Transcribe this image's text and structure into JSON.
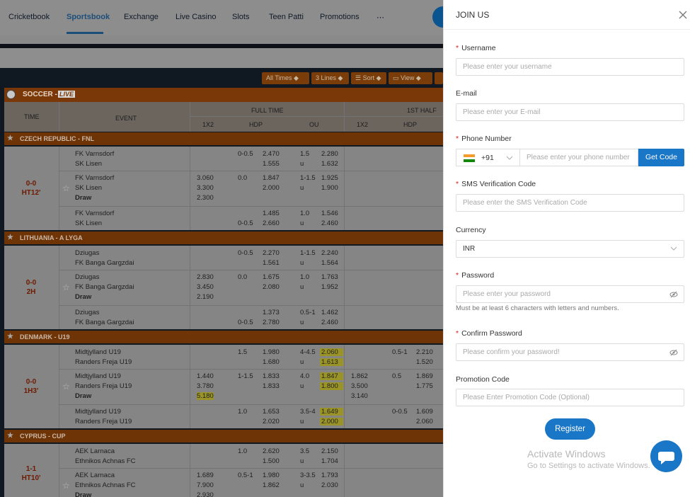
{
  "nav": {
    "items": [
      "Cricketbook",
      "Sportsbook",
      "Exchange",
      "Live Casino",
      "Slots",
      "Teen Patti",
      "Promotions",
      "⋯"
    ],
    "active": "Sportsbook"
  },
  "toolbar": {
    "all_times": "All Times",
    "lines": "3 Lines",
    "sort": "Sort",
    "view": "View"
  },
  "sport": {
    "name": "SOCCER -",
    "live": "LIVE"
  },
  "headers": {
    "time": "TIME",
    "event": "EVENT",
    "full_time": "FULL TIME",
    "first_half": "1ST HALF",
    "c1x2": "1X2",
    "hdp": "HDP",
    "ou": "OU",
    "c1x2b": "1X2",
    "hdpb": "HDP"
  },
  "leagues": [
    {
      "name": "CZECH REPUBLIC - FNL",
      "score": "0-0",
      "time": "HT12'",
      "rows": [
        {
          "teams": [
            "FK Varnsdorf",
            "SK Lisen"
          ],
          "x12": [],
          "hdp_line": [
            "0-0.5",
            ""
          ],
          "hdp": [
            "2.470",
            "1.555"
          ],
          "ou_line": [
            "1.5",
            "u"
          ],
          "ou": [
            "2.280",
            "1.632"
          ]
        },
        {
          "teams": [
            "FK Varnsdorf",
            "SK Lisen",
            "Draw"
          ],
          "x12": [
            "3.060",
            "3.300",
            "2.300"
          ],
          "hdp_line": [
            "0.0",
            ""
          ],
          "hdp": [
            "1.847",
            "2.000"
          ],
          "ou_line": [
            "1-1.5",
            "u"
          ],
          "ou": [
            "1.925",
            "1.900"
          ]
        },
        {
          "teams": [
            "FK Varnsdorf",
            "SK Lisen"
          ],
          "x12": [],
          "hdp_line": [
            "",
            "0-0.5"
          ],
          "hdp": [
            "1.485",
            "2.660"
          ],
          "ou_line": [
            "1.0",
            "u"
          ],
          "ou": [
            "1.546",
            "2.460"
          ]
        }
      ]
    },
    {
      "name": "LITHUANIA - A LYGA",
      "score": "0-0",
      "time": "2H",
      "rows": [
        {
          "teams": [
            "Dziugas",
            "FK Banga Gargzdai"
          ],
          "x12": [],
          "hdp_line": [
            "0-0.5",
            ""
          ],
          "hdp": [
            "2.270",
            "1.561"
          ],
          "ou_line": [
            "1-1.5",
            "u"
          ],
          "ou": [
            "2.240",
            "1.564"
          ]
        },
        {
          "teams": [
            "Dziugas",
            "FK Banga Gargzdai",
            "Draw"
          ],
          "x12": [
            "2.830",
            "3.450",
            "2.190"
          ],
          "hdp_line": [
            "0.0",
            ""
          ],
          "hdp": [
            "1.675",
            "2.080"
          ],
          "ou_line": [
            "1.0",
            "u"
          ],
          "ou": [
            "1.763",
            "1.952"
          ]
        },
        {
          "teams": [
            "Dziugas",
            "FK Banga Gargzdai"
          ],
          "x12": [],
          "hdp_line": [
            "",
            "0-0.5"
          ],
          "hdp": [
            "1.373",
            "2.780"
          ],
          "ou_line": [
            "0.5-1",
            "u"
          ],
          "ou": [
            "1.462",
            "2.460"
          ]
        }
      ]
    },
    {
      "name": "DENMARK - U19",
      "score": "0-0",
      "time": "1H3'",
      "rows": [
        {
          "teams": [
            "Midtjylland U19",
            "Randers Freja U19"
          ],
          "x12": [],
          "hdp_line": [
            "1.5",
            ""
          ],
          "hdp": [
            "1.980",
            "1.680"
          ],
          "ou_line": [
            "4-4.5",
            "u"
          ],
          "ou": [
            "2.060",
            "1.613"
          ],
          "ou_hl": true,
          "h_x12": [],
          "h_line": [
            "0.5-1",
            ""
          ],
          "h_hdp": [
            "2.210",
            "1.520"
          ]
        },
        {
          "teams": [
            "Midtjylland U19",
            "Randers Freja U19",
            "Draw"
          ],
          "x12": [
            "1.440",
            "3.780",
            "5.180"
          ],
          "hdp_line": [
            "1-1.5",
            ""
          ],
          "hdp": [
            "1.833",
            "1.833"
          ],
          "ou_line": [
            "4.0",
            "u"
          ],
          "ou": [
            "1.847",
            "1.800"
          ],
          "ou_hl": true,
          "h_x12": [
            "1.862",
            "3.500",
            "3.140"
          ],
          "h_line": [
            "0.5",
            ""
          ],
          "h_hdp": [
            "1.869",
            "1.775"
          ]
        },
        {
          "teams": [
            "Midtjylland U19",
            "Randers Freja U19"
          ],
          "x12": [],
          "hdp_line": [
            "1.0",
            ""
          ],
          "hdp": [
            "1.653",
            "2.020"
          ],
          "ou_line": [
            "3.5-4",
            "u"
          ],
          "ou": [
            "1.649",
            "2.000"
          ],
          "ou_hl": true,
          "h_x12": [],
          "h_line": [
            "0-0.5",
            ""
          ],
          "h_hdp": [
            "1.609",
            "2.060"
          ]
        }
      ]
    },
    {
      "name": "CYPRUS - CUP",
      "score": "1-1",
      "time": "HT10'",
      "rows": [
        {
          "teams": [
            "AEK Larnaca",
            "Ethnikos Achnas FC"
          ],
          "x12": [],
          "hdp_line": [
            "1.0",
            ""
          ],
          "hdp": [
            "2.620",
            "1.500"
          ],
          "ou_line": [
            "3.5",
            "u"
          ],
          "ou": [
            "2.150",
            "1.704"
          ]
        },
        {
          "teams": [
            "AEK Larnaca",
            "Ethnikos Achnas FC",
            "Draw"
          ],
          "x12": [
            "1.689",
            "7.900",
            "2.930"
          ],
          "hdp_line": [
            "0.5-1",
            ""
          ],
          "hdp": [
            "1.980",
            "1.862"
          ],
          "ou_line": [
            "3-3.5",
            "u"
          ],
          "ou": [
            "1.793",
            "2.030"
          ]
        }
      ]
    }
  ],
  "panel": {
    "title": "JOIN US",
    "username": {
      "label": "Username",
      "placeholder": "Please enter your username"
    },
    "email": {
      "label": "E-mail",
      "placeholder": "Please enter your E-mail"
    },
    "phone": {
      "label": "Phone Number",
      "code": "+91",
      "placeholder": "Please enter your phone number",
      "button": "Get Code"
    },
    "sms": {
      "label": "SMS Verification Code",
      "placeholder": "Please enter the SMS Verification Code"
    },
    "currency": {
      "label": "Currency",
      "value": "INR"
    },
    "password": {
      "label": "Password",
      "placeholder": "Please enter your password",
      "hint": "Must be at least 6 characters with letters and numbers."
    },
    "confirm": {
      "label": "Confirm Password",
      "placeholder": "Please confirm your password!"
    },
    "promo": {
      "label": "Promotion Code",
      "placeholder": "Please Enter Promotion Code (Optional)"
    },
    "register": "Register",
    "watermark1": "Activate Windows",
    "watermark2": "Go to Settings to activate Windows."
  }
}
